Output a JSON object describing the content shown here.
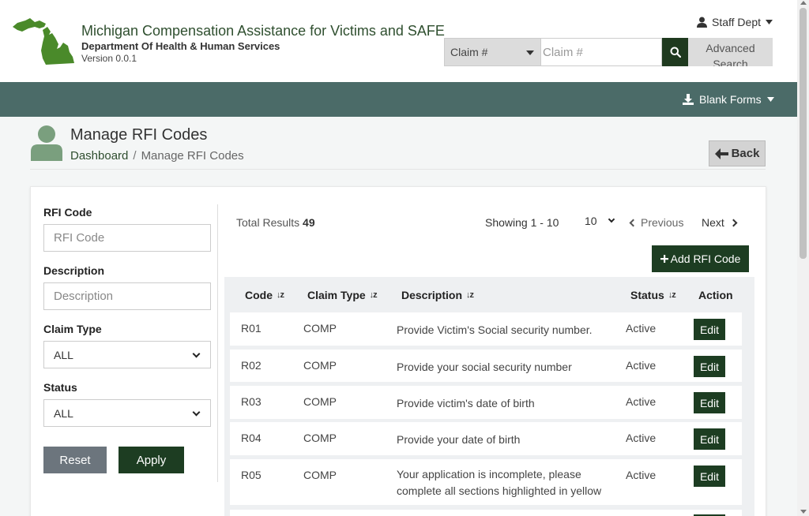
{
  "header": {
    "app_title": "Michigan Compensation Assistance for Victims and SAFE",
    "department": "Department Of Health & Human Services",
    "version": "Version 0.0.1",
    "user_menu_label": "Staff Dept",
    "search": {
      "type_selected": "Claim #",
      "placeholder": "Claim #",
      "advanced_label": "Advanced Search"
    }
  },
  "navbar": {
    "blank_forms_label": "Blank Forms"
  },
  "page": {
    "title": "Manage RFI Codes",
    "breadcrumb": {
      "home": "Dashboard",
      "separator": "/",
      "current": "Manage RFI Codes"
    },
    "back_label": "Back"
  },
  "filters": {
    "rfi_code": {
      "label": "RFI Code",
      "placeholder": "RFI Code"
    },
    "description": {
      "label": "Description",
      "placeholder": "Description"
    },
    "claim_type": {
      "label": "Claim Type",
      "selected": "ALL"
    },
    "status": {
      "label": "Status",
      "selected": "ALL"
    },
    "reset_label": "Reset",
    "apply_label": "Apply"
  },
  "results": {
    "total_label": "Total Results",
    "total_count": "49",
    "showing": "Showing 1 - 10",
    "page_size": "10",
    "prev_label": "Previous",
    "next_label": "Next",
    "add_label": "Add RFI Code"
  },
  "table": {
    "columns": {
      "code": "Code",
      "claim_type": "Claim Type",
      "description": "Description",
      "status": "Status",
      "action": "Action"
    },
    "edit_label": "Edit",
    "rows": [
      {
        "code": "R01",
        "claim_type": "COMP",
        "description": "Provide Victim's Social security number.",
        "status": "Active"
      },
      {
        "code": "R02",
        "claim_type": "COMP",
        "description": "Provide your social security number",
        "status": "Active"
      },
      {
        "code": "R03",
        "claim_type": "COMP",
        "description": "Provide victim's date of birth",
        "status": "Active"
      },
      {
        "code": "R04",
        "claim_type": "COMP",
        "description": "Provide your date of birth",
        "status": "Active"
      },
      {
        "code": "R05",
        "claim_type": "COMP",
        "description": "Your application is incomplete, please complete all sections highlighted in yellow",
        "status": "Active"
      }
    ]
  },
  "colors": {
    "brand_green": "#1d3d22",
    "navbar_teal": "#4b6b68",
    "michigan_green": "#4a8a2a"
  }
}
